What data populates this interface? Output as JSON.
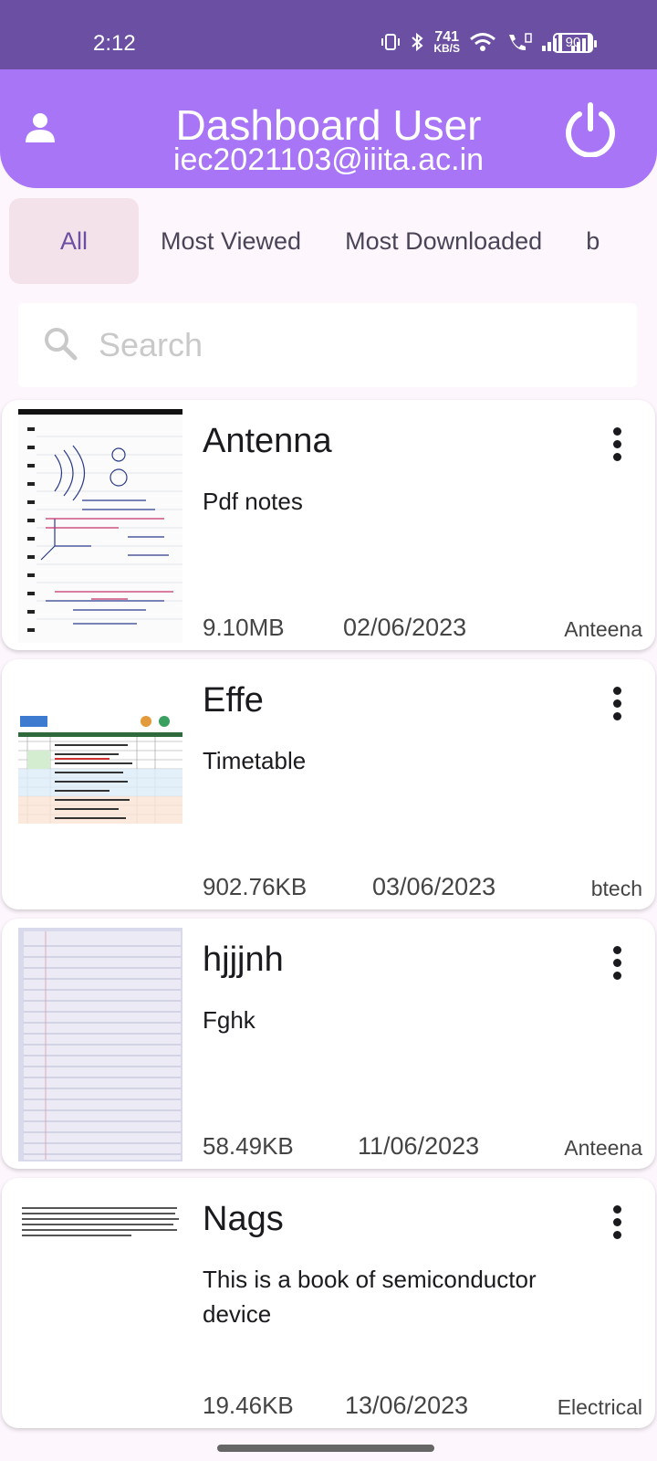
{
  "status_bar": {
    "time": "2:12",
    "net_speed_value": "741",
    "net_speed_unit": "KB/S",
    "battery": "90"
  },
  "header": {
    "title": "Dashboard User",
    "email": "iec2021103@iiita.ac.in",
    "bg_color": "#a775f6"
  },
  "tabs": [
    {
      "label": "All",
      "active": true
    },
    {
      "label": "Most Viewed"
    },
    {
      "label": "Most Downloaded"
    },
    {
      "label": "b"
    }
  ],
  "search": {
    "placeholder": "Search"
  },
  "files": [
    {
      "name": "Antenna",
      "description": "Pdf notes",
      "size": "9.10MB",
      "date": "02/06/2023",
      "category": "Anteena",
      "thumbnail": "handwritten-notes"
    },
    {
      "name": "Effe",
      "description": "Timetable",
      "size": "902.76KB",
      "date": "03/06/2023",
      "category": "btech",
      "thumbnail": "timetable"
    },
    {
      "name": "hjjjnh",
      "description": "Fghk",
      "size": "58.49KB",
      "date": "11/06/2023",
      "category": "Anteena",
      "thumbnail": "ruled-page"
    },
    {
      "name": "Nags",
      "description": "This is a book of semiconductor device",
      "size": "19.46KB",
      "date": "13/06/2023",
      "category": "Electrical",
      "thumbnail": "text-document"
    }
  ]
}
